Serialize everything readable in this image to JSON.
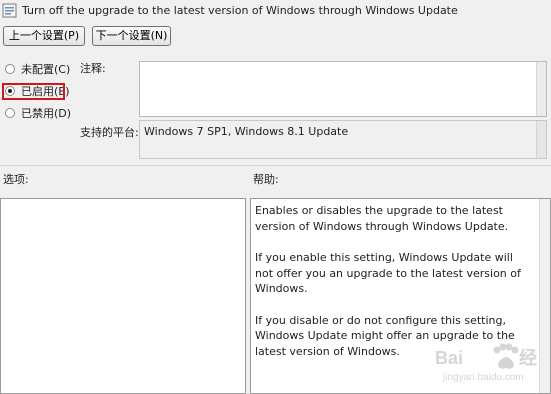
{
  "window": {
    "title": "Turn off the upgrade to the latest version of Windows through Windows Update"
  },
  "nav": {
    "prev_label": "上一个设置(P)",
    "next_label": "下一个设置(N)"
  },
  "state": {
    "options": [
      {
        "label": "未配置(C)",
        "selected": false
      },
      {
        "label": "已启用(E)",
        "selected": true
      },
      {
        "label": "已禁用(D)",
        "selected": false
      }
    ]
  },
  "comment": {
    "label": "注释:",
    "value": ""
  },
  "platform": {
    "label": "支持的平台:",
    "value": "Windows 7 SP1, Windows 8.1 Update"
  },
  "options_section": {
    "label": "选项:"
  },
  "help": {
    "label": "帮助:",
    "paragraphs": [
      "Enables or disables the upgrade to the latest version of Windows through Windows Update.",
      "If you enable this setting, Windows Update will not offer you an upgrade to the latest version of Windows.",
      "If you disable or do not configure this setting, Windows Update might offer an upgrade to the latest version of Windows."
    ]
  },
  "colors": {
    "highlight": "#d0181c",
    "background": "#f0f0f0"
  }
}
